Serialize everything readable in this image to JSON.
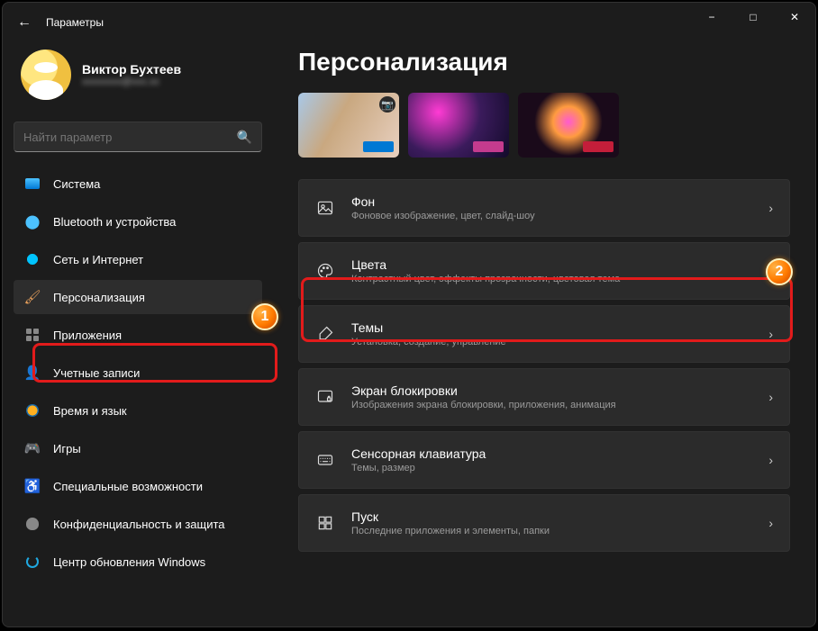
{
  "window": {
    "title": "Параметры"
  },
  "profile": {
    "name": "Виктор Бухтеев",
    "email": "xxxxxxxx@xxx.xx"
  },
  "search": {
    "placeholder": "Найти параметр"
  },
  "sidebar": {
    "items": [
      {
        "label": "Система"
      },
      {
        "label": "Bluetooth и устройства"
      },
      {
        "label": "Сеть и Интернет"
      },
      {
        "label": "Персонализация"
      },
      {
        "label": "Приложения"
      },
      {
        "label": "Учетные записи"
      },
      {
        "label": "Время и язык"
      },
      {
        "label": "Игры"
      },
      {
        "label": "Специальные возможности"
      },
      {
        "label": "Конфиденциальность и защита"
      },
      {
        "label": "Центр обновления Windows"
      }
    ]
  },
  "page": {
    "title": "Персонализация"
  },
  "options": [
    {
      "title": "Фон",
      "desc": "Фоновое изображение, цвет, слайд-шоу"
    },
    {
      "title": "Цвета",
      "desc": "Контрастный цвет, эффекты прозрачности, цветовая тема"
    },
    {
      "title": "Темы",
      "desc": "Установка, создание, управление"
    },
    {
      "title": "Экран блокировки",
      "desc": "Изображения экрана блокировки, приложения, анимация"
    },
    {
      "title": "Сенсорная клавиатура",
      "desc": "Темы, размер"
    },
    {
      "title": "Пуск",
      "desc": "Последние приложения и элементы, папки"
    }
  ],
  "annotations": {
    "badge1": "1",
    "badge2": "2"
  }
}
